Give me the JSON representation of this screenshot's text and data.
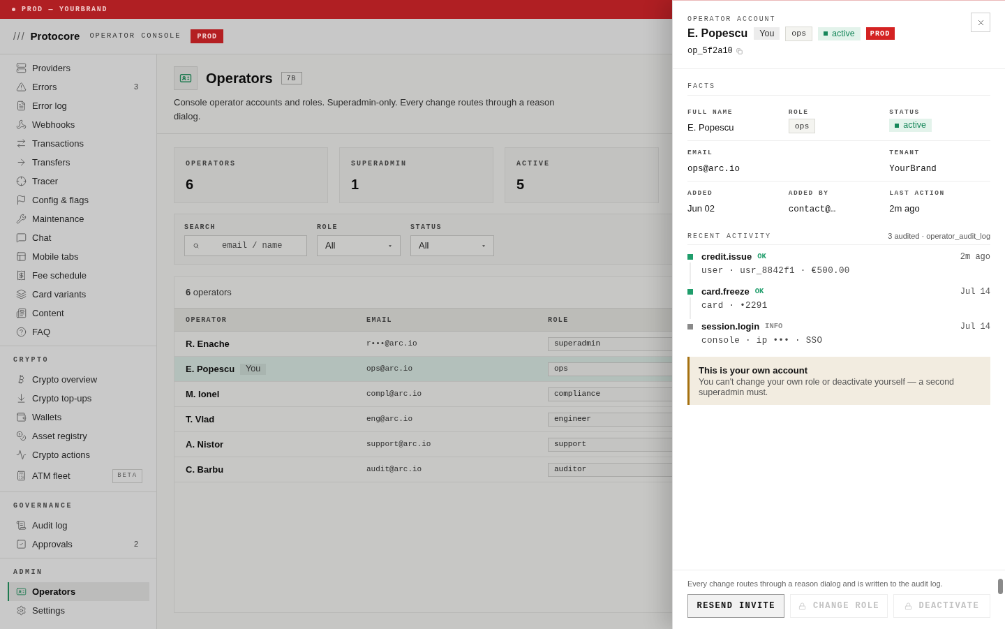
{
  "env_banner": {
    "label": "PROD — YOURBRAND"
  },
  "header": {
    "mark": "///",
    "brand": "Protocore",
    "subtitle": "OPERATOR CONSOLE",
    "env_badge": "PROD"
  },
  "sidebar": {
    "sections": [
      {
        "items": [
          {
            "label": "Providers",
            "selected": false
          },
          {
            "label": "Errors",
            "count": "3",
            "selected": false
          },
          {
            "label": "Error log",
            "selected": false
          },
          {
            "label": "Webhooks",
            "selected": false
          },
          {
            "label": "Transactions",
            "selected": false
          },
          {
            "label": "Transfers",
            "selected": false
          },
          {
            "label": "Tracer",
            "selected": false
          },
          {
            "label": "Config & flags",
            "selected": false
          },
          {
            "label": "Maintenance",
            "selected": false
          },
          {
            "label": "Chat",
            "selected": false
          },
          {
            "label": "Mobile tabs",
            "selected": false
          },
          {
            "label": "Fee schedule",
            "selected": false
          },
          {
            "label": "Card variants",
            "selected": false
          },
          {
            "label": "Content",
            "selected": false
          },
          {
            "label": "FAQ",
            "selected": false
          }
        ]
      },
      {
        "title": "CRYPTO",
        "items": [
          {
            "label": "Crypto overview",
            "selected": false
          },
          {
            "label": "Crypto top-ups",
            "selected": false
          },
          {
            "label": "Wallets",
            "selected": false
          },
          {
            "label": "Asset registry",
            "selected": false
          },
          {
            "label": "Crypto actions",
            "selected": false
          },
          {
            "label": "ATM fleet",
            "badge": "BETA",
            "selected": false
          }
        ]
      },
      {
        "title": "GOVERNANCE",
        "items": [
          {
            "label": "Audit log",
            "selected": false
          },
          {
            "label": "Approvals",
            "count": "2",
            "selected": false
          }
        ]
      },
      {
        "title": "ADMIN",
        "items": [
          {
            "label": "Operators",
            "selected": true
          },
          {
            "label": "Settings",
            "selected": false
          }
        ]
      }
    ]
  },
  "page": {
    "title": "Operators",
    "badge": "7B",
    "description": "Console operator accounts and roles. Superadmin-only. Every change routes through a reason dialog."
  },
  "stats": [
    {
      "label": "OPERATORS",
      "value": "6"
    },
    {
      "label": "SUPERADMIN",
      "value": "1"
    },
    {
      "label": "ACTIVE",
      "value": "5"
    }
  ],
  "filters": {
    "search": {
      "label": "SEARCH",
      "placeholder": "email / name"
    },
    "selects": [
      {
        "label": "ROLE",
        "value": "All"
      },
      {
        "label": "STATUS",
        "value": "All"
      }
    ]
  },
  "table": {
    "summary": "**6** operators",
    "columns": [
      "OPERATOR",
      "EMAIL",
      "ROLE"
    ],
    "rows": [
      {
        "name": "R. Enache",
        "email": "r•••@arc.io",
        "role": "superadmin",
        "selected": false
      },
      {
        "name": "E. Popescu",
        "tag": "You",
        "email": "ops@arc.io",
        "role": "ops",
        "selected": true
      },
      {
        "name": "M. Ionel",
        "email": "compl@arc.io",
        "role": "compliance",
        "selected": false
      },
      {
        "name": "T. Vlad",
        "email": "eng@arc.io",
        "role": "engineer",
        "selected": false
      },
      {
        "name": "A. Nistor",
        "email": "support@arc.io",
        "role": "support",
        "selected": false
      },
      {
        "name": "C. Barbu",
        "email": "audit@arc.io",
        "role": "auditor",
        "selected": false
      }
    ]
  },
  "drawer": {
    "eyebrow": "OPERATOR ACCOUNT",
    "name": "E. Popescu",
    "tags": [
      {
        "kind": "self",
        "text": "You"
      },
      {
        "kind": "role",
        "text": "ops"
      },
      {
        "kind": "status",
        "text": "active"
      },
      {
        "kind": "env",
        "text": "PROD"
      }
    ],
    "id": "op_5f2a10",
    "facts": {
      "title": "FACTS",
      "rows": [
        [
          {
            "label": "FULL NAME",
            "value": "E. Popescu",
            "kind": "text"
          },
          {
            "label": "ROLE",
            "value": "ops",
            "kind": "role"
          },
          {
            "label": "STATUS",
            "value": "active",
            "kind": "status"
          }
        ],
        [
          {
            "label": "EMAIL",
            "value": "ops@arc.io",
            "kind": "mono"
          },
          "",
          {
            "label": "TENANT",
            "value": "YourBrand",
            "kind": "mono"
          }
        ],
        [
          {
            "label": "ADDED",
            "value": "Jun 02",
            "kind": "text"
          },
          {
            "label": "ADDED BY",
            "value": "contact@…",
            "kind": "mono"
          },
          {
            "label": "LAST ACTION",
            "value": "2m ago",
            "kind": "text"
          }
        ]
      ]
    },
    "activity": {
      "title": "RECENT ACTIVITY",
      "summary": "3 audited · operator_audit_log",
      "items": [
        {
          "action": "credit.issue",
          "status": "OK",
          "time": "2m ago",
          "detail": "user · usr_8842f1 · €500.00",
          "color": "#1f9d6b"
        },
        {
          "action": "card.freeze",
          "status": "OK",
          "time": "Jul 14",
          "detail": "card · •2291",
          "color": "#1f9d6b"
        },
        {
          "action": "session.login",
          "status": "INFO",
          "time": "Jul 14",
          "detail": "console · ip ••• · SSO",
          "color": "#8a8a8a"
        }
      ]
    },
    "notice": {
      "title": "This is your own account",
      "body": "You can't change your own role or deactivate yourself — a second superadmin must."
    },
    "footer": {
      "note": "Every change routes through a reason dialog and is written to the audit log.",
      "actions": [
        {
          "label": "RESEND INVITE",
          "disabled": false
        },
        {
          "label": "CHANGE ROLE",
          "disabled": true
        },
        {
          "label": "DEACTIVATE",
          "disabled": true
        }
      ]
    }
  }
}
